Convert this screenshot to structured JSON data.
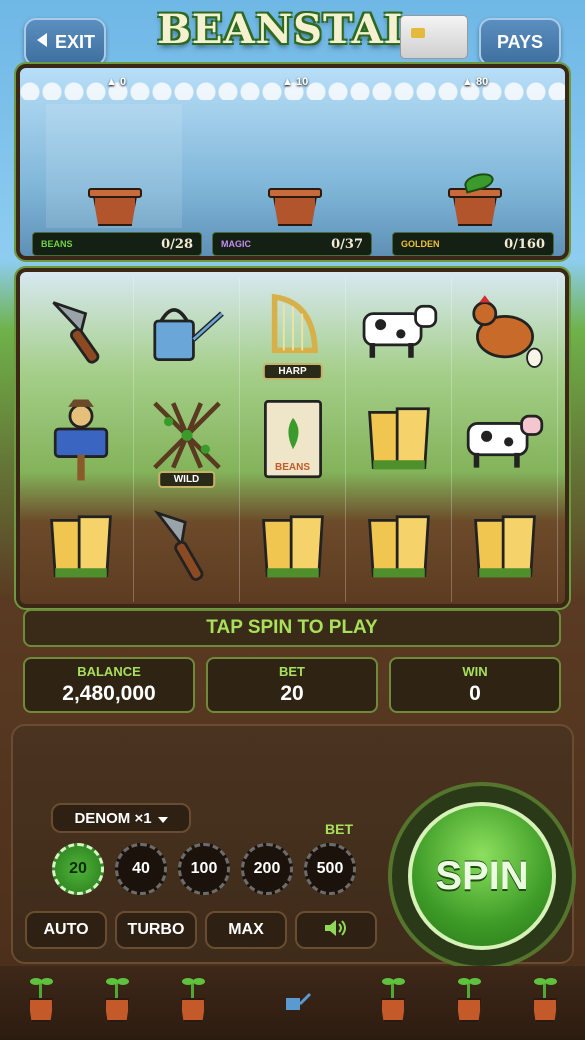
{
  "header": {
    "exit_label": "EXIT",
    "title": "BEANSTAL",
    "pays_label": "PAYS"
  },
  "progress": {
    "markers": [
      "0",
      "10",
      "80"
    ],
    "meters": [
      {
        "label": "BEANS",
        "count": "0/28",
        "color": "#6fd444"
      },
      {
        "label": "MAGIC",
        "count": "0/37",
        "color": "#c58ef0"
      },
      {
        "label": "GOLDEN",
        "count": "0/160",
        "color": "#f0c23a"
      }
    ]
  },
  "reels": {
    "symbols": [
      [
        "trowel",
        "watering-can",
        "harp",
        "cow",
        "hen"
      ],
      [
        "scarecrow",
        "wild-trellis",
        "bean-seed-packet",
        "gloves",
        "cow"
      ],
      [
        "gloves",
        "trowel",
        "gloves",
        "gloves",
        "gloves"
      ]
    ],
    "tags": {
      "harp": "HARP",
      "wild": "WILD",
      "packet": "BEANS"
    }
  },
  "message": "TAP SPIN TO PLAY",
  "stats": {
    "balance_label": "BALANCE",
    "balance_value": "2,480,000",
    "bet_label": "BET",
    "bet_value": "20",
    "win_label": "WIN",
    "win_value": "0"
  },
  "controls": {
    "denom_label": "DENOM ×1",
    "bet_label": "BET",
    "bet_options": [
      "20",
      "40",
      "100",
      "200",
      "500"
    ],
    "selected_bet": "20",
    "auto_label": "AUTO",
    "turbo_label": "TURBO",
    "max_label": "MAX",
    "sound_icon": "speaker-icon",
    "spin_label": "SPIN"
  },
  "colors": {
    "accent_green": "#a7e05a",
    "panel_border": "#6f8a3a"
  }
}
